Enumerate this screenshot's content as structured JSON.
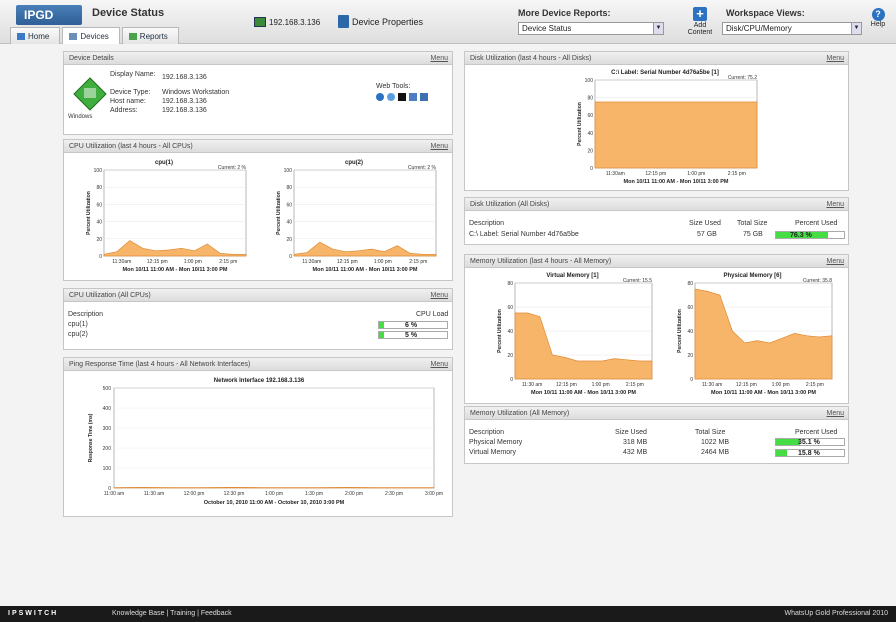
{
  "header": {
    "logo": "IPGD",
    "title": "Device Status",
    "tabs": [
      {
        "label": "Home"
      },
      {
        "label": "Devices"
      },
      {
        "label": "Reports"
      }
    ],
    "device_ip": "192.168.3.136",
    "device_properties": "Device Properties",
    "more_reports_label": "More Device Reports:",
    "more_reports_value": "Device Status",
    "add_content": "Add Content",
    "workspace_label": "Workspace Views:",
    "workspace_value": "Disk/CPU/Memory",
    "help": "Help"
  },
  "device_details": {
    "title": "Device Details",
    "menu": "Menu",
    "icon_label": "Windows",
    "fields": [
      {
        "label": "Display Name:",
        "value": "192.168.3.136"
      },
      {
        "label": "Device Type:",
        "value": "Windows Workstation"
      },
      {
        "label": "Host name:",
        "value": "192.168.3.136"
      },
      {
        "label": "Address:",
        "value": "192.168.3.136"
      }
    ],
    "web_tools": "Web Tools:"
  },
  "cpu_chart": {
    "title": "CPU Utilization (last 4 hours - All CPUs)",
    "menu": "Menu",
    "charts": [
      {
        "name": "cpu(1)",
        "series": "Current: 2 %",
        "ylabel": "Percent Utilization",
        "xticks": [
          "11:30am",
          "12:15 pm",
          "1:00 pm",
          "2:15 pm"
        ],
        "range": "Mon 10/11 11:00 AM - Mon 10/11 3:00 PM",
        "yticks": [
          "0",
          "20",
          "40",
          "60",
          "80",
          "100"
        ],
        "values": [
          2,
          5,
          18,
          9,
          6,
          7,
          9,
          6,
          14,
          3,
          2,
          2
        ]
      },
      {
        "name": "cpu(2)",
        "series": "Current: 2 %",
        "ylabel": "Percent Utilization",
        "xticks": [
          "11:30am",
          "12:15 pm",
          "1:00 pm",
          "2:15 pm"
        ],
        "range": "Mon 10/11 11:00 AM - Mon 10/11 3:00 PM",
        "yticks": [
          "0",
          "20",
          "40",
          "60",
          "80",
          "100"
        ],
        "values": [
          2,
          4,
          16,
          8,
          5,
          6,
          8,
          5,
          12,
          3,
          2,
          2
        ]
      }
    ]
  },
  "cpu_table": {
    "title": "CPU Utilization (All CPUs)",
    "menu": "Menu",
    "col_desc": "Description",
    "col_load": "CPU Load",
    "rows": [
      {
        "desc": "cpu(1)",
        "load": "6 %",
        "pct": 6
      },
      {
        "desc": "cpu(2)",
        "load": "5 %",
        "pct": 5
      }
    ]
  },
  "ping_chart": {
    "title": "Ping Response Time (last 4 hours - All Network Interfaces)",
    "menu": "Menu",
    "chart_title": "Network Interface 192.168.3.136",
    "ylabel": "Response Time (ms)",
    "yticks": [
      "0",
      "100",
      "200",
      "300",
      "400",
      "500"
    ],
    "xticks": [
      "11:00 am",
      "11:30 am",
      "12:00 pm",
      "12:30 pm",
      "1:00 pm",
      "1:30 pm",
      "2:00 pm",
      "2:30 pm",
      "3:00 pm"
    ],
    "range": "October 10, 2010 11:00 AM - October 10, 2010 3:00 PM",
    "values": [
      1,
      2,
      1,
      1,
      2,
      1,
      1,
      1,
      2,
      1,
      1,
      1
    ]
  },
  "disk_chart": {
    "title": "Disk Utilization (last 4 hours - All Disks)",
    "menu": "Menu",
    "chart_title": "C:\\ Label: Serial Number 4d76a5be [1]",
    "series": "Current: 75.2",
    "ylabel": "Percent Utilization",
    "yticks": [
      "0",
      "20",
      "40",
      "60",
      "80",
      "100"
    ],
    "xticks": [
      "11:30am",
      "12:15 pm",
      "1:00 pm",
      "2:15 pm"
    ],
    "range": "Mon 10/11 11:00 AM - Mon 10/11 3:00 PM",
    "values": [
      75,
      75,
      75,
      75,
      75,
      75
    ]
  },
  "disk_table": {
    "title": "Disk Utilization (All Disks)",
    "menu": "Menu",
    "cols": [
      "Description",
      "Size Used",
      "Total Size",
      "Percent Used"
    ],
    "rows": [
      {
        "desc": "C:\\ Label: Serial Number 4d76a5be",
        "used": "57 GB",
        "total": "75 GB",
        "pct_label": "76.3 %",
        "pct": 76.3
      }
    ]
  },
  "memory_chart": {
    "title": "Memory Utilization (last 4 hours - All Memory)",
    "menu": "Menu",
    "charts": [
      {
        "name": "Virtual Memory [1]",
        "series": "Current: 15.5",
        "ylabel": "Percent Utilization",
        "yticks": [
          "0",
          "20",
          "40",
          "60",
          "80"
        ],
        "xticks": [
          "11:30 am",
          "12:15 pm",
          "1:00 pm",
          "2:15 pm"
        ],
        "range": "Mon 10/11 11:00 AM - Mon 10/11 3:00 PM",
        "values": [
          55,
          55,
          52,
          20,
          18,
          15,
          15,
          15,
          17,
          16,
          15,
          15
        ]
      },
      {
        "name": "Physical Memory [6]",
        "series": "Current: 35.8",
        "ylabel": "Percent Utilization",
        "yticks": [
          "0",
          "20",
          "40",
          "60",
          "80"
        ],
        "xticks": [
          "11:30 am",
          "12:15 pm",
          "1:00 pm",
          "2:15 pm"
        ],
        "range": "Mon 10/11 11:00 AM - Mon 10/11 3:00 PM",
        "values": [
          75,
          73,
          70,
          40,
          30,
          32,
          30,
          34,
          38,
          36,
          35,
          36
        ]
      }
    ]
  },
  "memory_table": {
    "title": "Memory Utilization (All Memory)",
    "menu": "Menu",
    "cols": [
      "Description",
      "Size Used",
      "Total Size",
      "Percent Used"
    ],
    "rows": [
      {
        "desc": "Physical Memory",
        "used": "318 MB",
        "total": "1022 MB",
        "pct_label": "35.1 %",
        "pct": 35.1
      },
      {
        "desc": "Virtual Memory",
        "used": "432 MB",
        "total": "2464 MB",
        "pct_label": "15.8 %",
        "pct": 15.8
      }
    ]
  },
  "footer": {
    "brand": "IPSWITCH",
    "links": "Knowledge Base | Training | Feedback",
    "product": "WhatsUp Gold Professional 2010"
  },
  "colors": {
    "accent": "#2b72c2",
    "chart_fill": "#f7b56a",
    "chart_line": "#e08a33",
    "bar_green": "#44dd44"
  }
}
